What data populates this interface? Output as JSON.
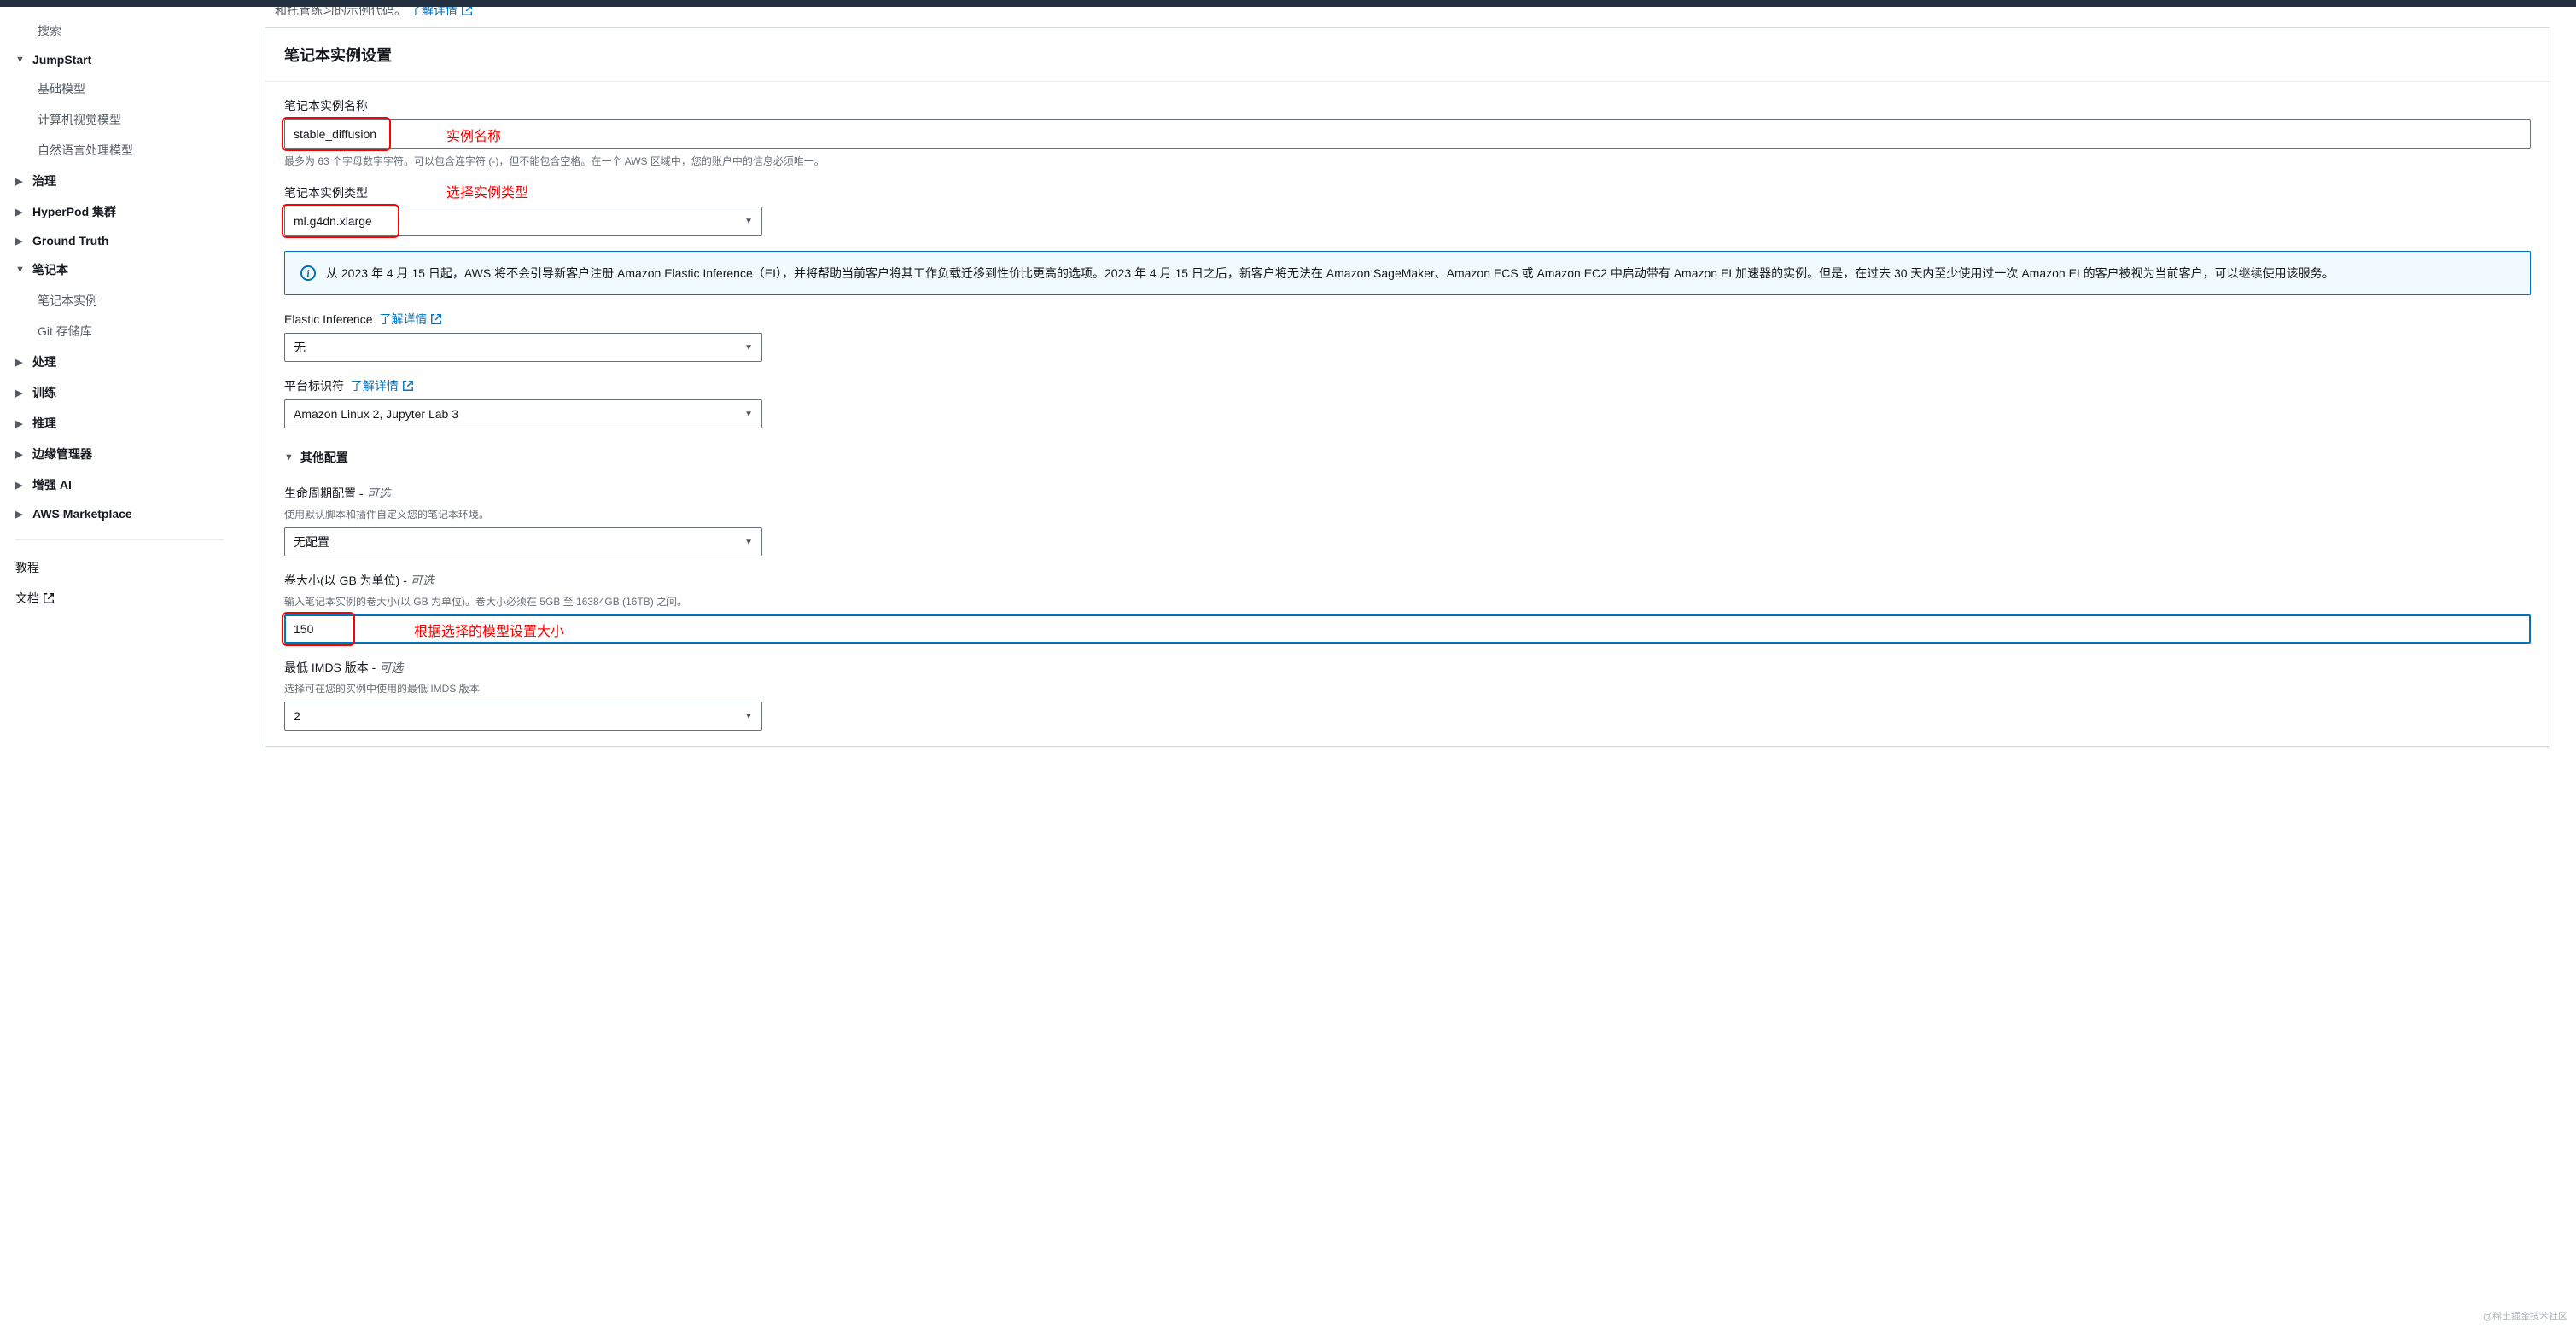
{
  "top_banner": {
    "truncated_text": "和托管练习的示例代码。",
    "link": "了解详情"
  },
  "sidebar": {
    "search": "搜索",
    "groups": [
      {
        "label": "JumpStart",
        "expanded": true,
        "children": [
          "基础模型",
          "计算机视觉模型",
          "自然语言处理模型"
        ]
      },
      {
        "label": "治理",
        "expanded": false
      },
      {
        "label": "HyperPod 集群",
        "expanded": false
      },
      {
        "label": "Ground Truth",
        "expanded": false
      },
      {
        "label": "笔记本",
        "expanded": true,
        "children": [
          "笔记本实例",
          "Git 存储库"
        ]
      },
      {
        "label": "处理",
        "expanded": false
      },
      {
        "label": "训练",
        "expanded": false
      },
      {
        "label": "推理",
        "expanded": false
      },
      {
        "label": "边缘管理器",
        "expanded": false
      },
      {
        "label": "增强 AI",
        "expanded": false
      },
      {
        "label": "AWS Marketplace",
        "expanded": false
      }
    ],
    "footer": {
      "tutorial": "教程",
      "docs": "文档"
    }
  },
  "panel": {
    "title": "笔记本实例设置",
    "name": {
      "label": "笔记本实例名称",
      "value": "stable_diffusion",
      "help": "最多为 63 个字母数字字符。可以包含连字符 (-)，但不能包含空格。在一个 AWS 区域中，您的账户中的信息必须唯一。",
      "annotation": "实例名称"
    },
    "type": {
      "label": "笔记本实例类型",
      "value": "ml.g4dn.xlarge",
      "annotation": "选择实例类型"
    },
    "info": "从 2023 年 4 月 15 日起，AWS 将不会引导新客户注册 Amazon Elastic Inference（EI），并将帮助当前客户将其工作负载迁移到性价比更高的选项。2023 年 4 月 15 日之后，新客户将无法在 Amazon SageMaker、Amazon ECS 或 Amazon EC2 中启动带有 Amazon EI 加速器的实例。但是，在过去 30 天内至少使用过一次 Amazon EI 的客户被视为当前客户，可以继续使用该服务。",
    "ei": {
      "label": "Elastic Inference",
      "link": "了解详情",
      "value": "无"
    },
    "platform": {
      "label": "平台标识符",
      "link": "了解详情",
      "value": "Amazon Linux 2, Jupyter Lab 3"
    },
    "other": {
      "header": "其他配置"
    },
    "lifecycle": {
      "label": "生命周期配置 - ",
      "optional": "可选",
      "help": "使用默认脚本和插件自定义您的笔记本环境。",
      "value": "无配置"
    },
    "volume": {
      "label": "卷大小(以 GB 为单位) - ",
      "optional": "可选",
      "help": "输入笔记本实例的卷大小(以 GB 为单位)。卷大小必须在 5GB 至 16384GB (16TB) 之间。",
      "value": "150",
      "annotation": "根据选择的模型设置大小"
    },
    "imds": {
      "label": "最低 IMDS 版本 - ",
      "optional": "可选",
      "help": "选择可在您的实例中使用的最低 IMDS 版本",
      "value": "2"
    }
  },
  "watermark": "@稀土掘金技术社区"
}
